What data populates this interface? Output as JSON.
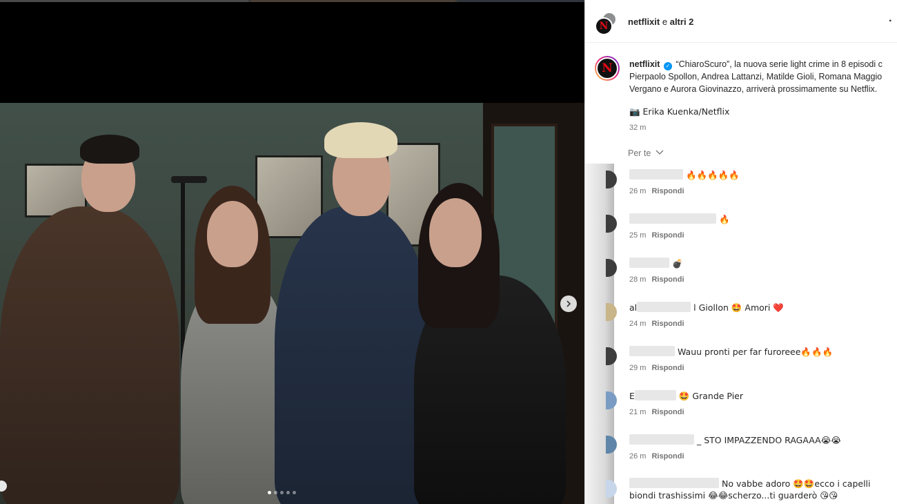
{
  "post_header": {
    "account": "netflixit",
    "connector": "e",
    "others": "altri 2",
    "more": "·"
  },
  "caption": {
    "username": "netflixit",
    "verified": "✓",
    "line1": "“ChiaroScuro”, la nuova serie light crime in 8 episodi c",
    "line2": "Pierpaolo Spollon, Andrea Lattanzi, Matilde Gioli, Romana Maggio",
    "line3": "Vergano e Aurora Giovinazzo, arriverà prossimamente su Netflix.",
    "credit": "📷 Erika Kuenka/Netflix",
    "time": "32 m"
  },
  "filter": {
    "label": "Per te",
    "icon": "chevron-down-icon"
  },
  "logo_letter": "N",
  "comments": [
    {
      "prefix": "",
      "text": "🔥🔥🔥🔥🔥",
      "time": "26 m",
      "reply": "Rispondi"
    },
    {
      "prefix": "",
      "text": "🔥",
      "time": "25 m",
      "reply": "Rispondi"
    },
    {
      "prefix": "",
      "text": "💣",
      "time": "28 m",
      "reply": "Rispondi"
    },
    {
      "prefix": "al",
      "text": "l Giollon 🤩 Amori ❤️",
      "time": "24 m",
      "reply": "Rispondi"
    },
    {
      "prefix": "",
      "text": "Wauu pronti per far furoreee🔥🔥🔥",
      "time": "29 m",
      "reply": "Rispondi"
    },
    {
      "prefix": "E",
      "text": "🤩 Grande Pier",
      "time": "21 m",
      "reply": "Rispondi"
    },
    {
      "prefix": "",
      "text": "_ STO IMPAZZENDO RAGAAA😭😭",
      "time": "26 m",
      "reply": "Rispondi"
    },
    {
      "prefix": "",
      "text": "No vabbe adoro 🤩🤩ecco i capelli",
      "text2": "biondi trashissimi 😂😂scherzo...ti guarderò 😘😘",
      "time": "",
      "reply": ""
    }
  ],
  "carousel": {
    "slides": 5,
    "active": 1
  }
}
